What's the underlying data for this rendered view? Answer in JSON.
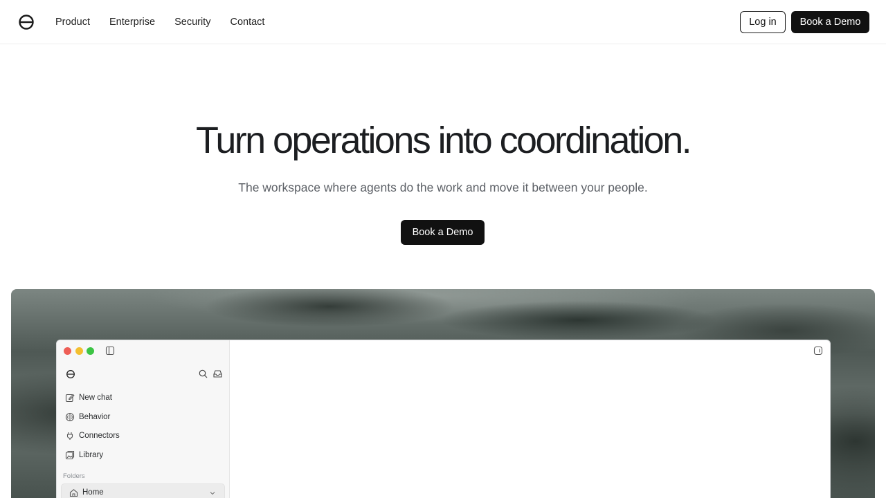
{
  "nav": {
    "logo_icon": "ring-logo-icon",
    "links": [
      "Product",
      "Enterprise",
      "Security",
      "Contact"
    ],
    "login_label": "Log in",
    "demo_label": "Book a Demo"
  },
  "hero": {
    "title": "Turn operations into coordination.",
    "subtitle": "The workspace where agents do the work and move it between your people.",
    "cta_label": "Book a Demo"
  },
  "app_preview": {
    "traffic_lights": [
      "#ee5e56",
      "#f3bf2f",
      "#3cc444"
    ],
    "sidebar": {
      "items": [
        {
          "label": "New chat",
          "icon": "compose-icon"
        },
        {
          "label": "Behavior",
          "icon": "brain-icon"
        },
        {
          "label": "Connectors",
          "icon": "plug-icon"
        },
        {
          "label": "Library",
          "icon": "library-icon"
        }
      ],
      "folders_label": "Folders",
      "home_label": "Home"
    }
  },
  "colors": {
    "primary_button": "#111111",
    "text": "#1c1e21",
    "subtext": "#5d6167"
  }
}
